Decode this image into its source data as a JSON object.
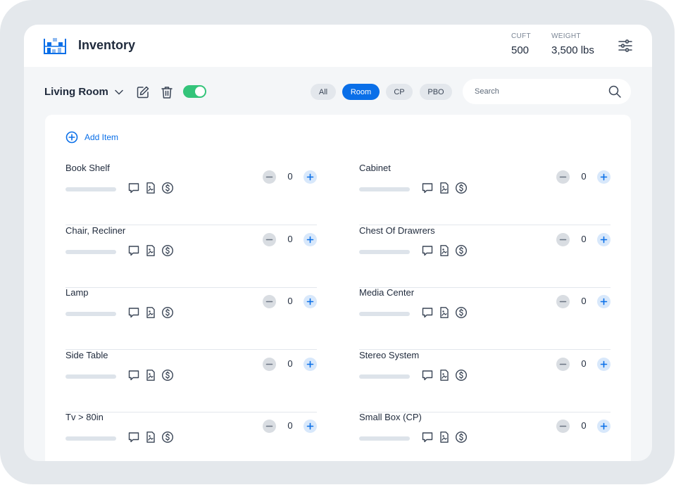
{
  "app": {
    "title": "Inventory",
    "stats": [
      {
        "label": "CUFT",
        "value": "500"
      },
      {
        "label": "WEIGHT",
        "value": "3,500 lbs"
      }
    ]
  },
  "toolbar": {
    "room": "Living Room",
    "toggle_on": true,
    "filters": [
      {
        "label": "All",
        "active": false
      },
      {
        "label": "Room",
        "active": true
      },
      {
        "label": "CP",
        "active": false
      },
      {
        "label": "PBO",
        "active": false
      }
    ],
    "search_placeholder": "Search",
    "search_value": ""
  },
  "card": {
    "add_item_label": "Add Item",
    "items_left": [
      {
        "name": "Book Shelf",
        "qty": "0"
      },
      {
        "name": "Chair, Recliner",
        "qty": "0"
      },
      {
        "name": "Lamp",
        "qty": "0"
      },
      {
        "name": "Side Table",
        "qty": "0"
      },
      {
        "name": "Tv > 80in",
        "qty": "0"
      }
    ],
    "items_right": [
      {
        "name": "Cabinet",
        "qty": "0"
      },
      {
        "name": "Chest Of Drawrers",
        "qty": "0"
      },
      {
        "name": "Media Center",
        "qty": "0"
      },
      {
        "name": "Stereo System",
        "qty": "0"
      },
      {
        "name": "Small Box (CP)",
        "qty": "0"
      }
    ]
  },
  "colors": {
    "accent": "#0a6fe8",
    "toggle_on": "#34c47a",
    "frame": "#e4e8ec",
    "background": "#f4f6f8"
  },
  "icons": [
    "inventory-logo-icon",
    "sliders-icon",
    "chevron-down-icon",
    "edit-icon",
    "trash-icon",
    "search-icon",
    "plus-circle-icon",
    "comment-icon",
    "photo-file-icon",
    "dollar-icon",
    "minus-icon",
    "plus-icon"
  ]
}
